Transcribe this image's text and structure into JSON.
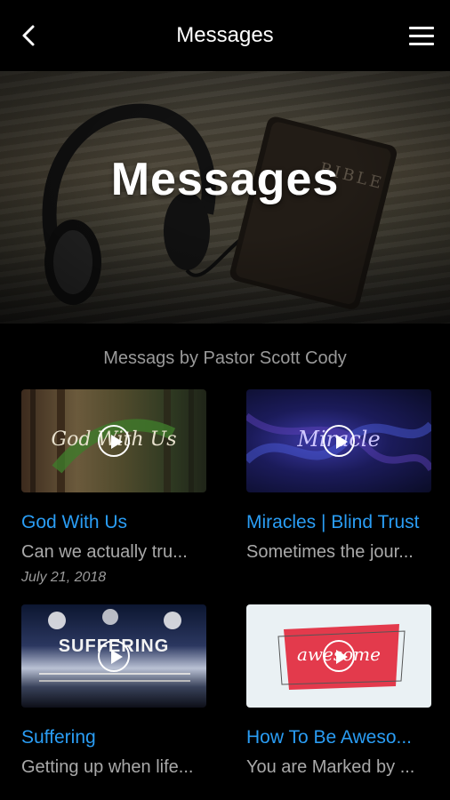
{
  "header": {
    "title": "Messages"
  },
  "hero": {
    "title": "Messages"
  },
  "section": {
    "subtitle": "Messags by Pastor Scott Cody"
  },
  "cards": [
    {
      "title": "God With Us",
      "description": "Can we actually tru...",
      "date": "July 21, 2018",
      "thumb_text": "God With Us"
    },
    {
      "title": "Miracles | Blind Trust",
      "description": "Sometimes the jour...",
      "thumb_text": "Miracle"
    },
    {
      "title": "Suffering",
      "description": "Getting up when life...",
      "thumb_text": "SUFFERING"
    },
    {
      "title": "How To Be Aweso...",
      "description": "You are Marked by ...",
      "thumb_text": "awesome"
    }
  ]
}
